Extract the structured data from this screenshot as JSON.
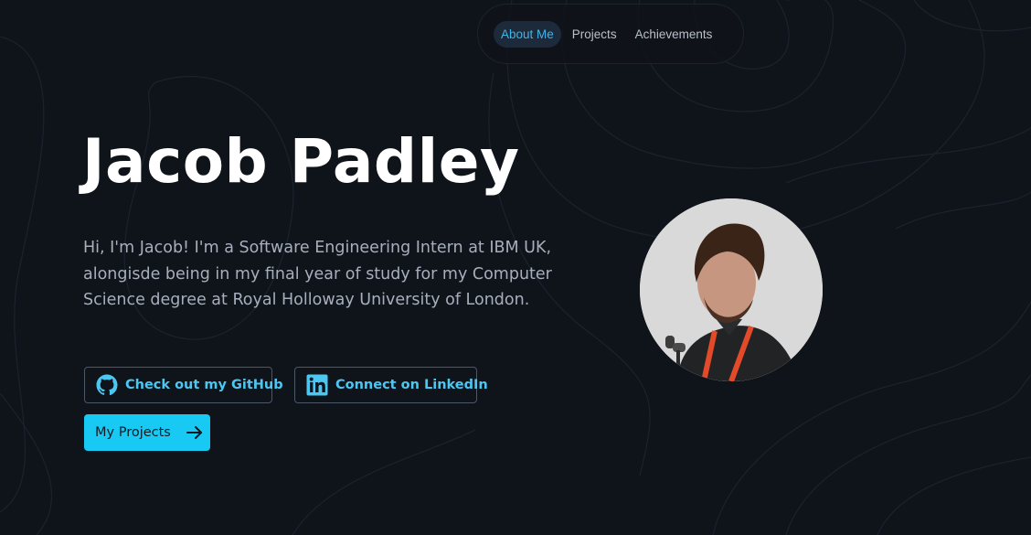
{
  "nav": {
    "items": [
      {
        "label": "About Me",
        "active": true
      },
      {
        "label": "Projects",
        "active": false
      },
      {
        "label": "Achievements",
        "active": false
      }
    ]
  },
  "hero": {
    "name": "Jacob Padley",
    "bio": "Hi, I'm Jacob! I'm a Software Engineering Intern at IBM UK, alongisde being in my final year of study for my Computer Science degree at Royal Holloway University of London."
  },
  "buttons": {
    "github": {
      "label": "Check out my GitHub",
      "icon": "github-icon"
    },
    "linkedin": {
      "label": "Connect on LinkedIn",
      "icon": "linkedin-icon"
    },
    "projects": {
      "label": "My Projects",
      "icon": "arrow-right-icon"
    }
  },
  "colors": {
    "background": "#0f131a",
    "accent": "#18c9f4",
    "accent_text": "#4cc7f2",
    "nav_active_bg": "#1c2a3b"
  }
}
